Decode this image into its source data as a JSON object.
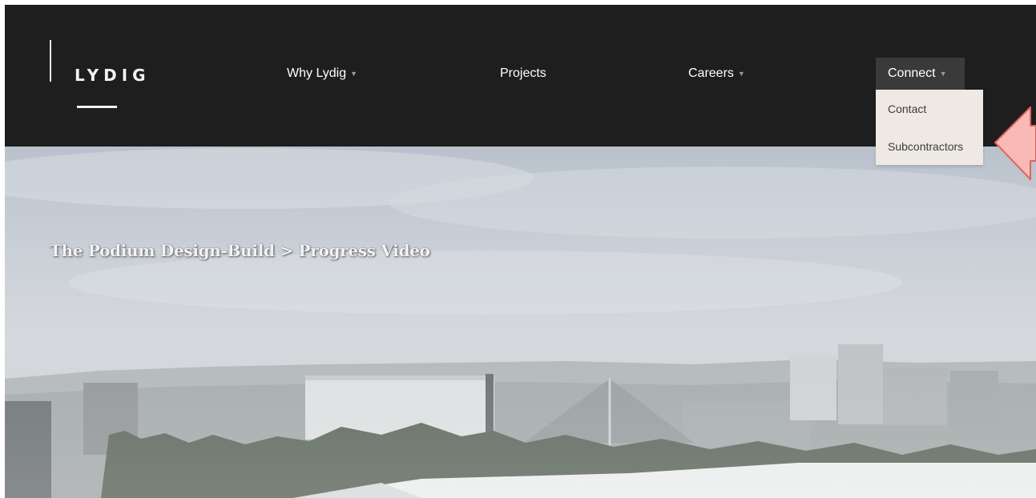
{
  "header": {
    "logo_text": "LYDIG"
  },
  "nav": {
    "why_label": "Why Lydig",
    "projects_label": "Projects",
    "careers_label": "Careers",
    "connect_label": "Connect",
    "caret": "▼"
  },
  "connect_menu": {
    "items": [
      {
        "label": "Contact"
      },
      {
        "label": "Subcontractors"
      }
    ]
  },
  "hero": {
    "title": "The Podium Design-Build > Progress Video"
  },
  "colors": {
    "header_bg": "#1e1e1e",
    "active_nav_bg": "#3a3a3a",
    "dropdown_bg": "#eee9e4",
    "arrow_fill": "#f9b9b6",
    "arrow_stroke": "#e0645e"
  }
}
